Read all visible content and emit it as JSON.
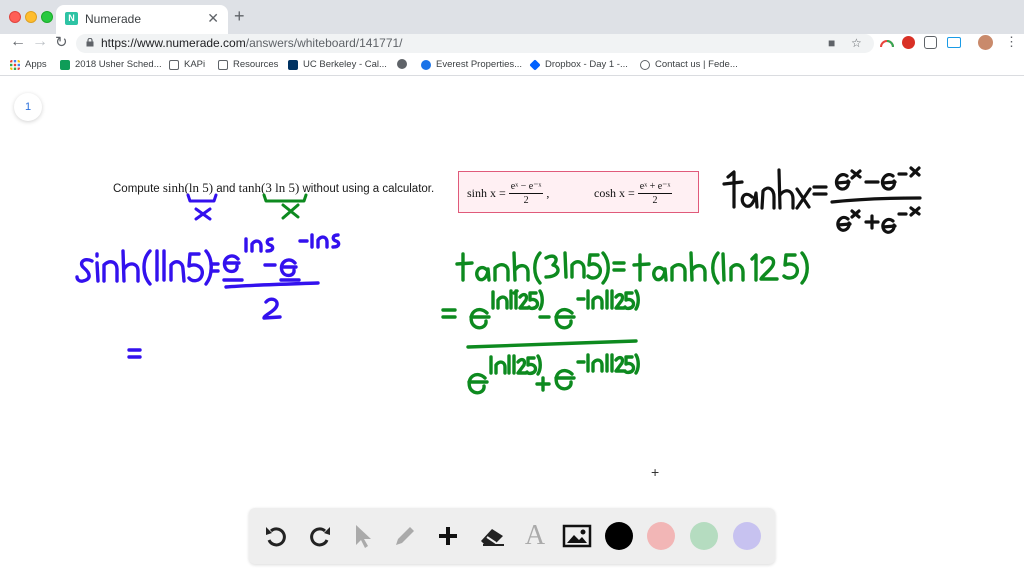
{
  "browser": {
    "tab_title": "Numerade",
    "tab_favicon_letter": "N",
    "url_host": "https://www.numerade.com",
    "url_path": "/answers/whiteboard/141771/",
    "bookmarks": [
      {
        "label": "Apps",
        "icon": "apps-grid-icon",
        "color": "#4285f4"
      },
      {
        "label": "2018 Usher Sched...",
        "icon": "sheets-icon",
        "color": "#0f9d58"
      },
      {
        "label": "KAPi",
        "icon": "folder-icon",
        "color": "#5f6368"
      },
      {
        "label": "Resources",
        "icon": "folder-icon",
        "color": "#5f6368"
      },
      {
        "label": "UC Berkeley - Cal...",
        "icon": "berkeley-icon",
        "color": "#003262"
      },
      {
        "label": "",
        "icon": "globe-icon",
        "color": "#5f6368"
      },
      {
        "label": "Everest Properties...",
        "icon": "everest-icon",
        "color": "#1a73e8"
      },
      {
        "label": "Dropbox - Day 1 -...",
        "icon": "dropbox-icon",
        "color": "#0061ff"
      },
      {
        "label": "Contact us | Fede...",
        "icon": "contact-icon",
        "color": "#5f6368"
      }
    ]
  },
  "whiteboard": {
    "page_number": "1",
    "problem": {
      "prefix": "Compute ",
      "expr1": "sinh(ln 5)",
      "middle": " and ",
      "expr2": "tanh(3 ln 5)",
      "suffix": " without using a calculator."
    },
    "definitions": {
      "sinh_lhs": "sinh x =",
      "sinh_num": "eˣ − e⁻ˣ",
      "sinh_den": "2",
      "cosh_lhs": "cosh x =",
      "cosh_num": "eˣ + e⁻ˣ",
      "cosh_den": "2"
    },
    "handwriting": {
      "tanh_def": "tanh x = (e^x - e^-x)/(e^x + e^-x)",
      "x_label_1": "x",
      "x_label_2": "x",
      "sinh_line": "sinh(ln5) = (e^ln5 - e^-ln5)/2",
      "equals_line": "=",
      "tanh_line": "tanh(3ln5) = tanh(ln125)",
      "tanh_expansion": "= (e^ln(125) - e^-ln(125))/(e^ln(125) + e^-ln(125))"
    }
  },
  "palette": {
    "tools": [
      "undo-icon",
      "redo-icon",
      "pointer-icon",
      "pen-icon",
      "plus-icon",
      "eraser-icon",
      "text-icon",
      "image-icon"
    ],
    "colors": [
      "#000000",
      "#f2b6b6",
      "#b5dcc0",
      "#c7c2f0"
    ]
  },
  "colors": {
    "ink_blue": "#3311ee",
    "ink_green": "#0d8a1f",
    "ink_black": "#111111",
    "definition_border": "#e05a7a"
  }
}
